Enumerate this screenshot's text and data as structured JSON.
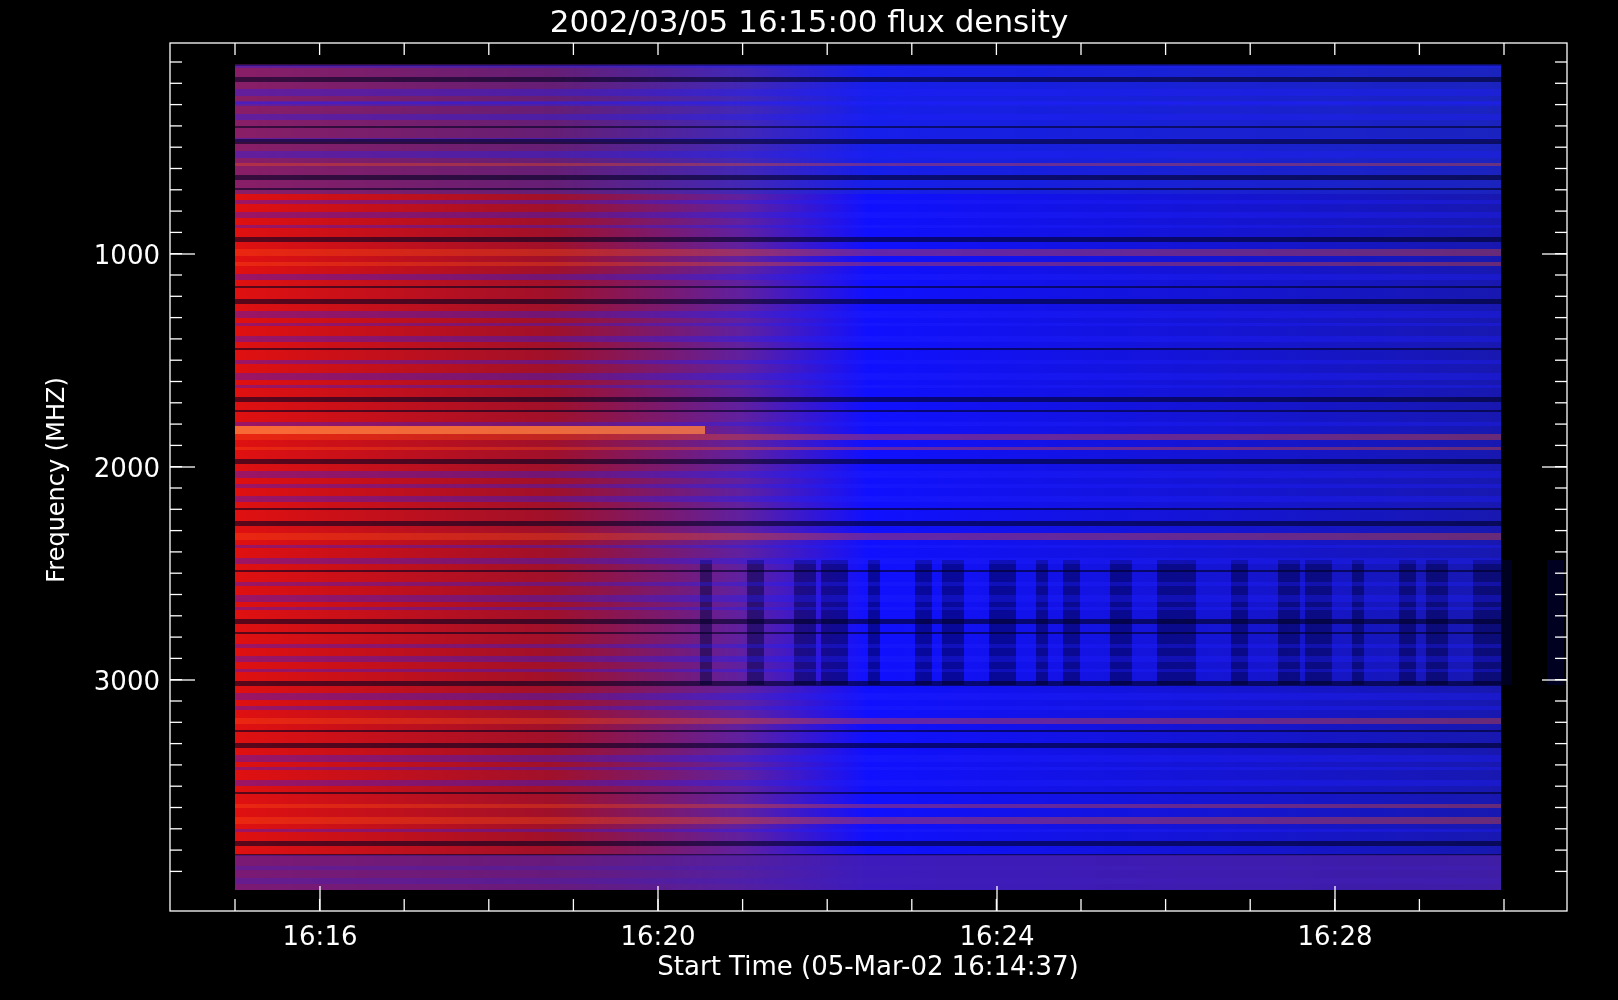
{
  "title": "2002/03/05 16:15:00 flux density",
  "ylabel": "Frequency (MHZ)",
  "xlabel": "Start Time (05-Mar-02 16:14:37)",
  "yticks": [
    {
      "label": "1000"
    },
    {
      "label": "2000"
    },
    {
      "label": "3000"
    }
  ],
  "xticks": [
    {
      "label": "16:16"
    },
    {
      "label": "16:20"
    },
    {
      "label": "16:24"
    },
    {
      "label": "16:28"
    }
  ]
}
